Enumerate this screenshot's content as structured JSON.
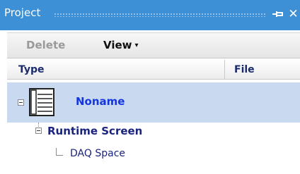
{
  "window": {
    "title": "Project",
    "pin_icon": "pin-icon",
    "close_icon": "close-icon",
    "close_glyph": "✕"
  },
  "toolbar": {
    "delete_label": "Delete",
    "view_label": "View",
    "view_caret": "▾"
  },
  "columns": {
    "type": "Type",
    "file": "File"
  },
  "tree": {
    "root": {
      "label": "Noname",
      "icon": "document-list-icon",
      "selected": true
    },
    "child": {
      "label": "Runtime Screen"
    },
    "grandchild": {
      "label": "DAQ Space"
    }
  },
  "colors": {
    "title_bar": "#3d8fd6",
    "selection": "#c9d9ef",
    "root_label": "#1436e0",
    "tree_label": "#1a237e"
  }
}
